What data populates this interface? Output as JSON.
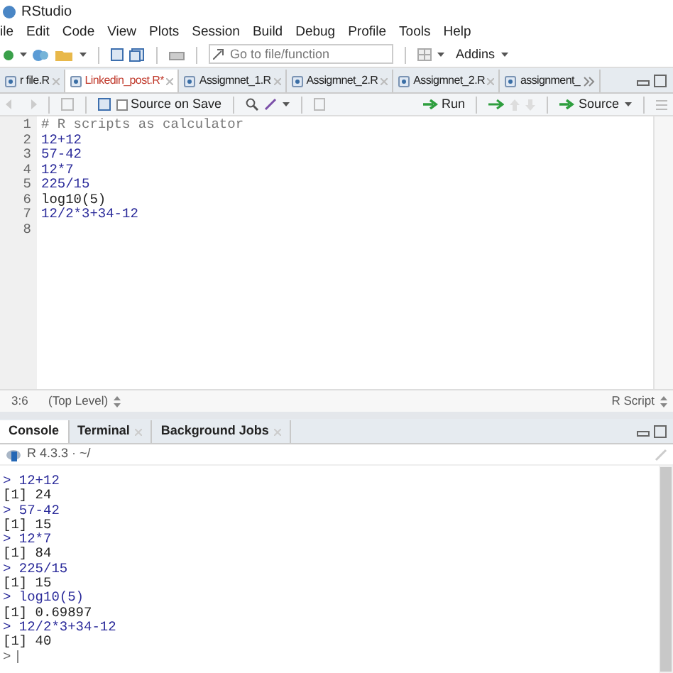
{
  "window": {
    "title": "RStudio"
  },
  "menu": [
    "ile",
    "Edit",
    "Code",
    "View",
    "Plots",
    "Session",
    "Build",
    "Debug",
    "Profile",
    "Tools",
    "Help"
  ],
  "toolbar": {
    "goto": {
      "placeholder": "Go to file/function"
    },
    "addins": "Addins"
  },
  "tabs": [
    {
      "label": "r file.R",
      "selected": false,
      "modified": false
    },
    {
      "label": "Linkedin_post.R*",
      "selected": true,
      "modified": true
    },
    {
      "label": "Assigmnet_1.R",
      "selected": false,
      "modified": false
    },
    {
      "label": "Assigmnet_2.R",
      "selected": false,
      "modified": false
    },
    {
      "label": "Assigmnet_2.R",
      "selected": false,
      "modified": false
    },
    {
      "label": "assignment_",
      "selected": false,
      "modified": false
    }
  ],
  "editor_toolbar": {
    "source_on_save": {
      "label": "Source on Save",
      "checked": false
    },
    "run": "Run",
    "source": "Source"
  },
  "line_numbers": [
    "1",
    "2",
    "3",
    "4",
    "5",
    "6",
    "7",
    "8"
  ],
  "code": [
    {
      "kind": "comment",
      "text": "# R scripts as calculator"
    },
    {
      "kind": "code",
      "text": "12+12"
    },
    {
      "kind": "code",
      "text": "57-42"
    },
    {
      "kind": "code",
      "text": "12*7"
    },
    {
      "kind": "code",
      "text": "225/15"
    },
    {
      "kind": "call",
      "text": "log10(5)"
    },
    {
      "kind": "code",
      "text": "12/2*3+34-12"
    }
  ],
  "status_bar": {
    "position": "3:6",
    "scope": "(Top Level)",
    "file_type": "R Script"
  },
  "console_tabs": [
    {
      "label": "Console",
      "selected": true,
      "closable": false
    },
    {
      "label": "Terminal",
      "selected": false,
      "closable": true
    },
    {
      "label": "Background Jobs",
      "selected": false,
      "closable": true
    }
  ],
  "console_header": "R 4.3.3 · ~/",
  "console": [
    {
      "kind": "input",
      "text": "> 12+12"
    },
    {
      "kind": "output",
      "text": "[1] 24"
    },
    {
      "kind": "input",
      "text": "> 57-42"
    },
    {
      "kind": "output",
      "text": "[1] 15"
    },
    {
      "kind": "input",
      "text": "> 12*7"
    },
    {
      "kind": "output",
      "text": "[1] 84"
    },
    {
      "kind": "input",
      "text": "> 225/15"
    },
    {
      "kind": "output",
      "text": "[1] 15"
    },
    {
      "kind": "input",
      "text": "> log10(5)"
    },
    {
      "kind": "output",
      "text": "[1] 0.69897"
    },
    {
      "kind": "input",
      "text": "> 12/2*3+34-12"
    },
    {
      "kind": "output",
      "text": "[1] 40"
    }
  ],
  "prompt": ">"
}
